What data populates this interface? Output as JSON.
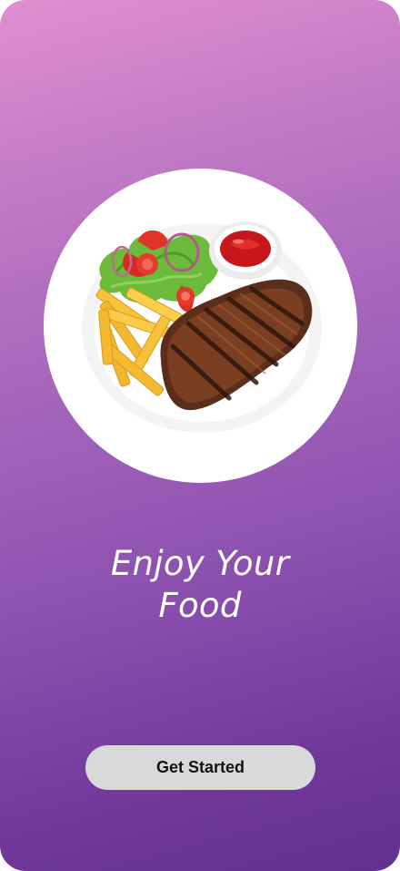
{
  "onboarding": {
    "headline_line1": "Enjoy Your",
    "headline_line2": "Food",
    "cta_label": "Get Started",
    "hero_image": "steak-with-fries-salad-and-ketchup-plate"
  },
  "colors": {
    "gradient_top": "#e08fd0",
    "gradient_bottom": "#63308f",
    "button_bg": "#d9d9d9",
    "button_text": "#111111",
    "headline": "#ffffff"
  }
}
